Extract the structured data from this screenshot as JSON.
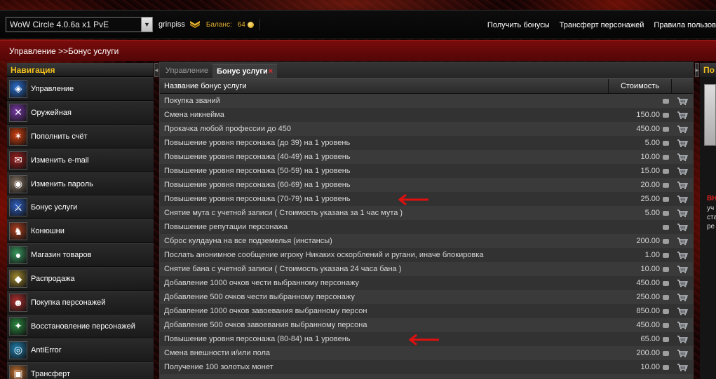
{
  "topbar": {
    "realm_select": "WoW Circle 4.0.6a x1 PvE",
    "username": "grinpiss",
    "balance_label": "Баланс:",
    "balance_value": "64",
    "links": [
      "Получить бонусы",
      "Трансферт персонажей",
      "Правила пользова"
    ]
  },
  "breadcrumb": "Управление >>Бонус услуги",
  "nav": {
    "title": "Навигация",
    "items": [
      {
        "label": "Управление",
        "icon": "shield-icon"
      },
      {
        "label": "Оружейная",
        "icon": "swords-icon"
      },
      {
        "label": "Пополнить счёт",
        "icon": "fire-icon"
      },
      {
        "label": "Изменить e-mail",
        "icon": "envelope-icon"
      },
      {
        "label": "Изменить пароль",
        "icon": "eye-icon"
      },
      {
        "label": "Бонус услуги",
        "icon": "sword-icon"
      },
      {
        "label": "Конюшни",
        "icon": "horse-icon"
      },
      {
        "label": "Магазин товаров",
        "icon": "globe-icon"
      },
      {
        "label": "Распродажа",
        "icon": "sale-icon"
      },
      {
        "label": "Покупка персонажей",
        "icon": "character-icon"
      },
      {
        "label": "Восстановление персонажей",
        "icon": "restore-icon"
      },
      {
        "label": "AntiError",
        "icon": "vortex-icon"
      },
      {
        "label": "Трансферт",
        "icon": "transfer-icon"
      }
    ]
  },
  "tabs": [
    {
      "label": "Управление",
      "active": false
    },
    {
      "label": "Бонус услуги",
      "active": true
    }
  ],
  "table": {
    "col_name": "Название бонус услуги",
    "col_cost": "Стоимость",
    "rows": [
      {
        "name": "Покупка званий",
        "cost": ""
      },
      {
        "name": "Смена никнейма",
        "cost": "150.00"
      },
      {
        "name": "Прокачка любой профессии до 450",
        "cost": "450.00"
      },
      {
        "name": "Повышение уровня персонажа (до 39) на 1 уровень",
        "cost": "5.00"
      },
      {
        "name": "Повышение уровня персонажа (40-49) на 1 уровень",
        "cost": "10.00"
      },
      {
        "name": "Повышение уровня персонажа (50-59) на 1 уровень",
        "cost": "15.00"
      },
      {
        "name": "Повышение уровня персонажа (60-69) на 1 уровень",
        "cost": "20.00"
      },
      {
        "name": "Повышение уровня персонажа (70-79) на 1 уровень",
        "cost": "25.00"
      },
      {
        "name": "Снятие мута с учетной записи ( Стоимость указана за 1 час мута )",
        "cost": "5.00"
      },
      {
        "name": "Повышение репутации персонажа",
        "cost": ""
      },
      {
        "name": "Сброс кулдауна на все подземелья (инстансы)",
        "cost": "200.00"
      },
      {
        "name": "Послать анонимное сообщение игроку Никаких оскорблений и ругани, иначе блокировка",
        "cost": "1.00"
      },
      {
        "name": "Снятие бана с учетной записи ( Стоимость указана 24 часа бана )",
        "cost": "10.00"
      },
      {
        "name": "Добавление 1000 очков чести выбранному персонажу",
        "cost": "450.00"
      },
      {
        "name": "Добавление 500 очков чести выбранному персонажу",
        "cost": "250.00"
      },
      {
        "name": "Добавление 1000 очков завоевания выбранному персон",
        "cost": "850.00"
      },
      {
        "name": "Добавление 500 очков завоевания выбранному персона",
        "cost": "450.00"
      },
      {
        "name": "Повышение уровня персонажа (80-84) на 1 уровень",
        "cost": "65.00"
      },
      {
        "name": "Смена внешности и/или пола",
        "cost": "200.00"
      },
      {
        "name": "Получение 100 золотых монет",
        "cost": "10.00"
      },
      {
        "name": "",
        "cost": ""
      }
    ]
  },
  "right_panel": {
    "title": "По",
    "red_text": "ВН",
    "lines": [
      "уч",
      "ста",
      "ре"
    ]
  },
  "colors": {
    "accent_gold": "#f3c11b",
    "crumb_red": "#7a0c0c",
    "arrow_red": "#e01010"
  }
}
